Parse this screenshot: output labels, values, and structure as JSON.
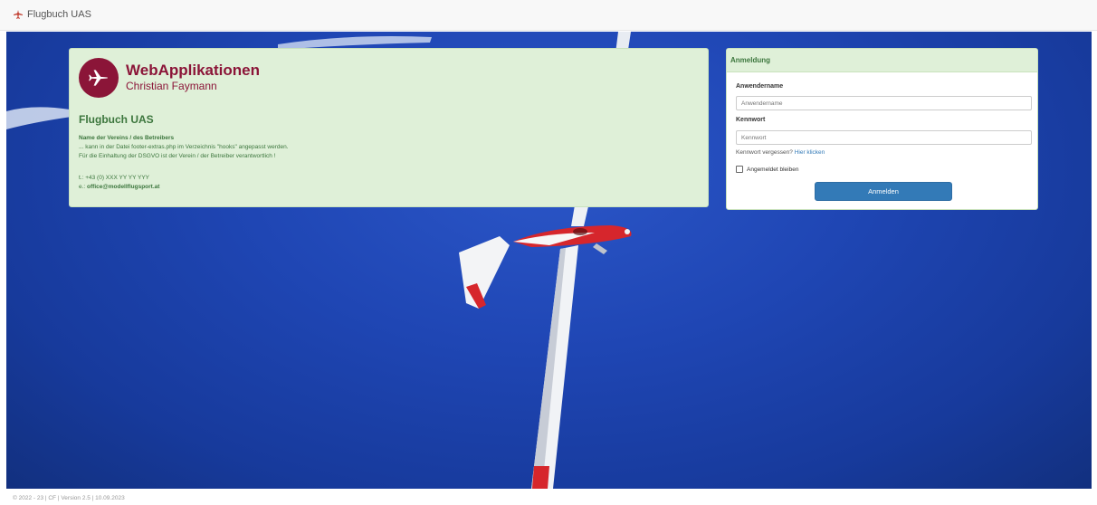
{
  "app": {
    "title": "Flugbuch UAS",
    "accent": "#c0392b"
  },
  "info": {
    "company_title": "WebApplikationen",
    "company_sub": "Christian Faymann",
    "heading": "Flugbuch UAS",
    "club_label": "Name der Vereins / des Betreibers",
    "line1": "... kann in der Datei footer-extras.php im Verzeichnis \"hooks\" angepasst werden.",
    "line2": "Für die Einhaltung der DSGVO ist der Verein / der Betreiber verantwortlich !",
    "phone": "t.: +43 (0) XXX YY YY YYY",
    "email_prefix": "e.:",
    "email": "office@modellflugsport.at"
  },
  "login": {
    "title": "Anmeldung",
    "username_label": "Anwendername",
    "username_placeholder": "Anwendername",
    "password_label": "Kennwort",
    "password_placeholder": "Kennwort",
    "forgot_text": "Kennwort vergessen?",
    "forgot_link": "Hier klicken",
    "remember_label": "Angemeldet bleiben",
    "submit_label": "Anmelden"
  },
  "footer": {
    "text": "© 2022 - 23 | CF | Version 2.5 | 10.09.2023"
  }
}
